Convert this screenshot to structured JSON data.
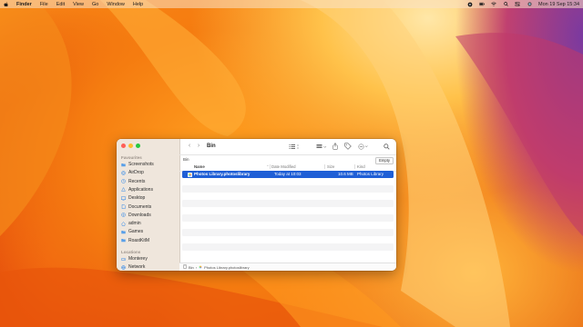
{
  "menubar": {
    "app": "Finder",
    "items": [
      "File",
      "Edit",
      "View",
      "Go",
      "Window",
      "Help"
    ],
    "clock": "Mon 19 Sep  15:34"
  },
  "window": {
    "title": "Bin",
    "path_label": "Bin",
    "empty_button": "Empty",
    "sidebar": {
      "favourites_heading": "Favourites",
      "favourites": [
        {
          "label": "Screenshots",
          "icon": "folder-icon"
        },
        {
          "label": "AirDrop",
          "icon": "airdrop-icon"
        },
        {
          "label": "Recents",
          "icon": "clock-icon"
        },
        {
          "label": "Applications",
          "icon": "applications-icon"
        },
        {
          "label": "Desktop",
          "icon": "desktop-icon"
        },
        {
          "label": "Documents",
          "icon": "document-icon"
        },
        {
          "label": "Downloads",
          "icon": "download-icon"
        },
        {
          "label": "admin",
          "icon": "home-icon"
        },
        {
          "label": "Games",
          "icon": "folder-icon"
        },
        {
          "label": "RoastKitM",
          "icon": "folder-icon"
        }
      ],
      "locations_heading": "Locations",
      "locations": [
        {
          "label": "Monterey",
          "icon": "disk-icon"
        },
        {
          "label": "Network",
          "icon": "network-icon"
        }
      ]
    },
    "columns": {
      "name": "Name",
      "date": "Date Modified",
      "size": "Size",
      "kind": "Kind"
    },
    "files": [
      {
        "name": "Photos Library.photoslibrary",
        "date": "Today at 10:03",
        "size": "10.6 MB",
        "kind": "Photos Library"
      }
    ],
    "statusbar": {
      "bin": "Bin",
      "file": "Photos Library.photoslibrary"
    },
    "accent": "#1f5fd6"
  }
}
